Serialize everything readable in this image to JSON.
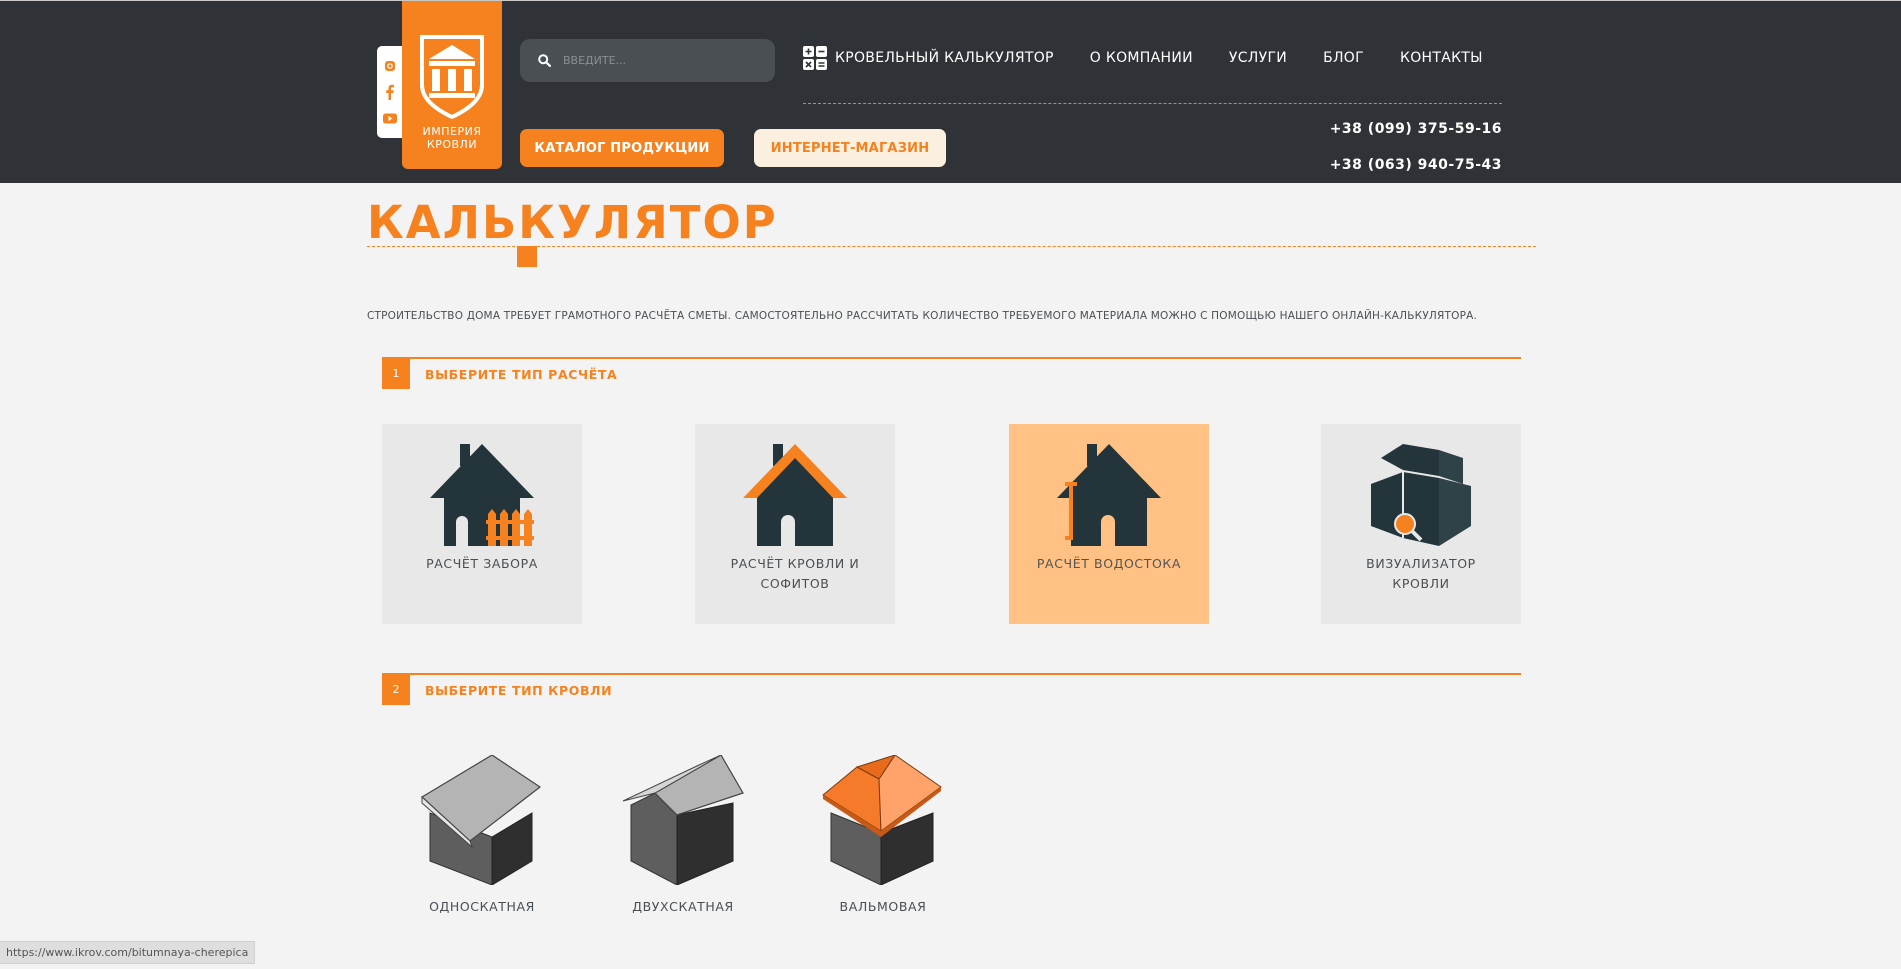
{
  "header": {
    "logo_line1": "ИМПЕРИЯ",
    "logo_line2": "КРОВЛИ",
    "search_placeholder": "ВВЕДИТЕ...",
    "nav": {
      "calculator": "КРОВЕЛЬНЫЙ КАЛЬКУЛЯТОР",
      "about": "О КОМПАНИИ",
      "services": "УСЛУГИ",
      "blog": "БЛОГ",
      "contacts": "КОНТАКТЫ"
    },
    "catalog_button": "КАТАЛОГ ПРОДУКЦИИ",
    "shop_button": "ИНТЕРНЕТ-МАГАЗИН",
    "phone1": "+38 (099) 375-59-16",
    "phone2": "+38 (063) 940-75-43",
    "socials": [
      "instagram-icon",
      "facebook-icon",
      "youtube-icon"
    ]
  },
  "main": {
    "title": "КАЛЬКУЛЯТОР",
    "intro": "СТРОИТЕЛЬСТВО ДОМА ТРЕБУЕТ ГРАМОТНОГО РАСЧЁТА СМЕТЫ. САМОСТОЯТЕЛЬНО РАССЧИТАТЬ КОЛИЧЕСТВО ТРЕБУЕМОГО МАТЕРИАЛА МОЖНО С ПОМОЩЬЮ НАШЕГО ОНЛАЙН-КАЛЬКУЛЯТОРА.",
    "step1": {
      "number": "1",
      "title": "ВЫБЕРИТЕ ТИП РАСЧЁТА",
      "cards": [
        {
          "label": "РАСЧЁТ ЗАБОРА",
          "icon": "fence-house-icon",
          "active": false
        },
        {
          "label": "РАСЧЁТ КРОВЛИ И СОФИТОВ",
          "icon": "roof-house-icon",
          "active": false
        },
        {
          "label": "РАСЧЁТ ВОДОСТОКА",
          "icon": "gutter-house-icon",
          "active": true
        },
        {
          "label": "ВИЗУАЛИЗАТОР КРОВЛИ",
          "icon": "visualizer-icon",
          "active": false
        }
      ]
    },
    "step2": {
      "number": "2",
      "title": "ВЫБЕРИТЕ ТИП КРОВЛИ",
      "roofs": [
        {
          "label": "ОДНОСКАТНАЯ",
          "icon": "single-pitch-roof-icon"
        },
        {
          "label": "ДВУХСКАТНАЯ",
          "icon": "gable-roof-icon"
        },
        {
          "label": "ВАЛЬМОВАЯ",
          "icon": "hip-roof-icon"
        }
      ]
    }
  },
  "status_bar_url": "https://www.ikrov.com/bitumnaya-cherepica",
  "colors": {
    "accent": "#f5821f",
    "header_bg": "#2f3337",
    "page_bg": "#f3f3f3",
    "card_bg": "#e8e8e8",
    "card_active_bg": "#ffc184",
    "dark_icon": "#23353b"
  }
}
